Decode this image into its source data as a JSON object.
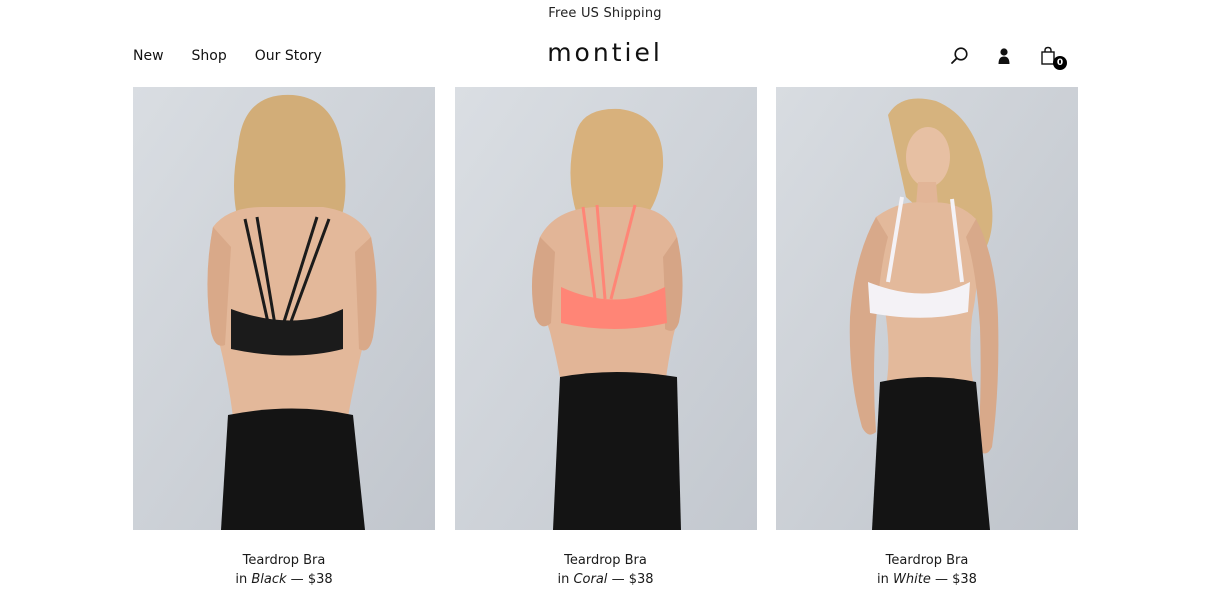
{
  "announcement": "Free US Shipping",
  "nav": {
    "items": [
      {
        "label": "New"
      },
      {
        "label": "Shop"
      },
      {
        "label": "Our Story"
      }
    ]
  },
  "brand": {
    "logo": "montiel"
  },
  "header_icons": {
    "search": "search-icon",
    "account": "user-icon",
    "cart": "shopping-bag-icon",
    "cart_count": "0"
  },
  "products": [
    {
      "name": "Teardrop Bra",
      "prefix": "in",
      "color": "Black",
      "separator": "—",
      "price": "$38",
      "swatch": "#1b1b1b",
      "view": "back"
    },
    {
      "name": "Teardrop Bra",
      "prefix": "in",
      "color": "Coral",
      "separator": "—",
      "price": "$38",
      "swatch": "#ff8576",
      "view": "back"
    },
    {
      "name": "Teardrop Bra",
      "prefix": "in",
      "color": "White",
      "separator": "—",
      "price": "$38",
      "swatch": "#f4f2f6",
      "view": "front"
    }
  ]
}
